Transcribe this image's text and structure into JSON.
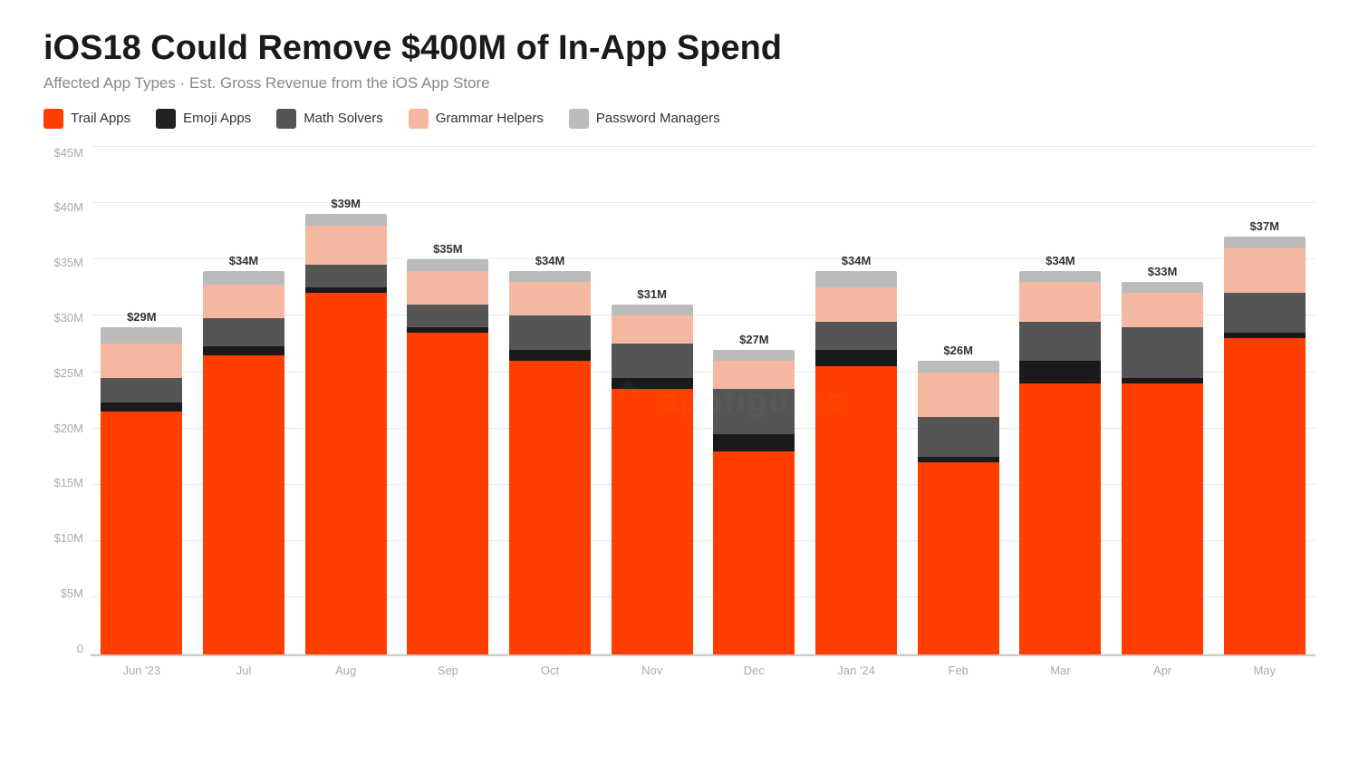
{
  "title": "iOS18 Could Remove $400M of In-App Spend",
  "subtitle": "Affected App Types · Est. Gross Revenue from the iOS App Store",
  "legend": [
    {
      "label": "Trail Apps",
      "color": "#FF3E00"
    },
    {
      "label": "Emoji Apps",
      "color": "#222222"
    },
    {
      "label": "Math Solvers",
      "color": "#555555"
    },
    {
      "label": "Grammar Helpers",
      "color": "#F4B8A0"
    },
    {
      "label": "Password Managers",
      "color": "#BBBBBB"
    }
  ],
  "yAxis": {
    "labels": [
      "0",
      "$5M",
      "$10M",
      "$15M",
      "$20M",
      "$25M",
      "$30M",
      "$35M",
      "$40M",
      "$45M"
    ],
    "max": 45,
    "step": 5
  },
  "bars": [
    {
      "month": "Jun '23",
      "total": "$29M",
      "trail": 21.5,
      "emoji": 0.8,
      "math": 2.2,
      "grammar": 3.0,
      "password": 1.5
    },
    {
      "month": "Jul",
      "total": "$34M",
      "trail": 26.5,
      "emoji": 0.8,
      "math": 2.5,
      "grammar": 3.0,
      "password": 1.2
    },
    {
      "month": "Aug",
      "total": "$39M",
      "trail": 32.0,
      "emoji": 0.5,
      "math": 2.0,
      "grammar": 3.5,
      "password": 1.0
    },
    {
      "month": "Sep",
      "total": "$35M",
      "trail": 28.5,
      "emoji": 0.5,
      "math": 2.0,
      "grammar": 3.0,
      "password": 1.0
    },
    {
      "month": "Oct",
      "total": "$34M",
      "trail": 26.0,
      "emoji": 1.0,
      "math": 3.0,
      "grammar": 3.0,
      "password": 1.0
    },
    {
      "month": "Nov",
      "total": "$31M",
      "trail": 23.5,
      "emoji": 1.0,
      "math": 3.0,
      "grammar": 2.5,
      "password": 1.0
    },
    {
      "month": "Dec",
      "total": "$27M",
      "trail": 18.0,
      "emoji": 1.5,
      "math": 4.0,
      "grammar": 2.5,
      "password": 1.0
    },
    {
      "month": "Jan '24",
      "total": "$34M",
      "trail": 25.5,
      "emoji": 1.5,
      "math": 2.5,
      "grammar": 3.0,
      "password": 1.5
    },
    {
      "month": "Feb",
      "total": "$26M",
      "trail": 17.0,
      "emoji": 0.5,
      "math": 3.5,
      "grammar": 4.0,
      "password": 1.0
    },
    {
      "month": "Mar",
      "total": "$34M",
      "trail": 24.0,
      "emoji": 2.0,
      "math": 3.5,
      "grammar": 3.5,
      "password": 1.0
    },
    {
      "month": "Apr",
      "total": "$33M",
      "trail": 24.0,
      "emoji": 0.5,
      "math": 4.5,
      "grammar": 3.0,
      "password": 1.0
    },
    {
      "month": "May",
      "total": "$37M",
      "trail": 28.0,
      "emoji": 0.5,
      "math": 3.5,
      "grammar": 4.0,
      "password": 1.0
    }
  ],
  "watermark": "appfigures",
  "colors": {
    "trail": "#FF3E00",
    "emoji": "#1a1a1a",
    "math": "#555555",
    "grammar": "#F4B8A0",
    "password": "#BBBBBB"
  }
}
